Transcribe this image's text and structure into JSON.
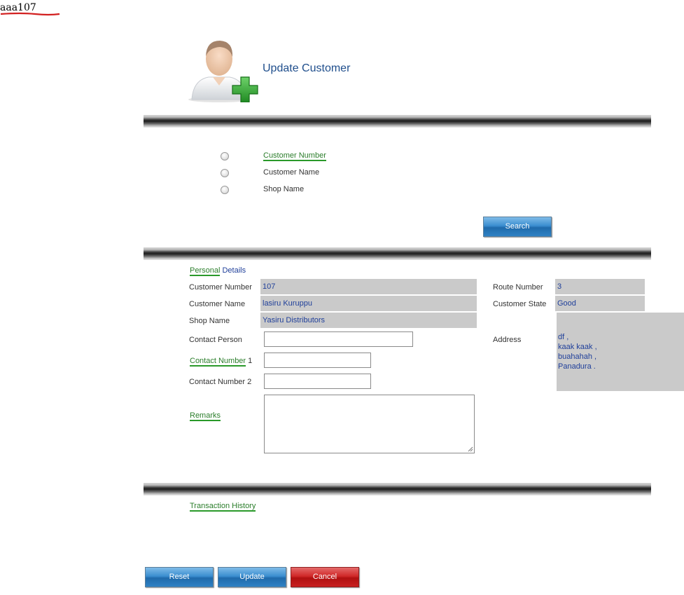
{
  "user": {
    "tag": "aaa107"
  },
  "header": {
    "title": "Update Customer"
  },
  "search": {
    "options": [
      "Customer Number",
      "Customer Name",
      "Shop Name"
    ],
    "button_label": "Search"
  },
  "personal": {
    "heading_link": "Personal",
    "heading_rest": " Details",
    "customer_number_label": "Customer Number",
    "customer_number_value": "107",
    "customer_name_label": "Customer Name",
    "customer_name_value": "lasiru Kuruppu",
    "shop_name_label": "Shop Name",
    "shop_name_value": "Yasiru Distributors",
    "contact_person_label": "Contact Person",
    "contact_number1_link": "Contact Number",
    "contact_number1_suffix": " 1",
    "contact_number2_label": "Contact Number 2",
    "remarks_label": "Remarks",
    "route_number_label": "Route Number",
    "route_number_value": "3",
    "customer_state_label": "Customer State",
    "customer_state_value": "Good",
    "address_label": "Address",
    "address_lines": [
      "df ,",
      "kaak kaak ,",
      "buahahah ,",
      "Panadura ."
    ]
  },
  "transactions": {
    "heading": "Transaction History"
  },
  "actions": {
    "reset": "Reset",
    "update": "Update",
    "cancel": "Cancel"
  },
  "colors": {
    "title": "#1f4e8c",
    "link": "#2a7d2a",
    "readonly_bg": "#cacaca",
    "readonly_text": "#1f3f9a",
    "primary_button": "#2f82c4",
    "danger_button": "#c82020"
  }
}
